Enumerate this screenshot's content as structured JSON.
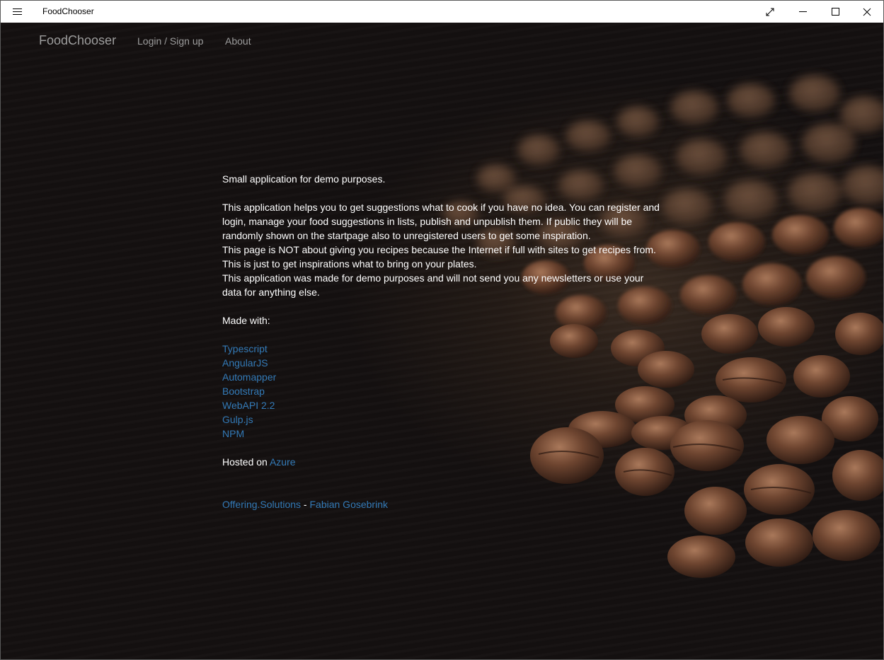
{
  "window": {
    "title": "FoodChooser"
  },
  "navbar": {
    "brand": "FoodChooser",
    "login": "Login / Sign up",
    "about": "About"
  },
  "main": {
    "intro": "Small application for demo purposes.",
    "description_lines": [
      "This application helps you to get suggestions what to cook if you have no idea. You can register and",
      "login, manage your food suggestions in lists, publish and unpublish them. If public they will be",
      "randomly shown on the startpage also to unregistered users to get some inspiration.",
      "This page is NOT about giving you recipes because the Internet if full with sites to get recipes from.",
      "This is just to get inspirations what to bring on your plates.",
      "This application was made for demo purposes and will not send you any newsletters or use your",
      "data for anything else."
    ],
    "made_with_label": "Made with:",
    "technologies": [
      "Typescript",
      "AngularJS",
      "Automapper",
      "Bootstrap",
      "WebAPI 2.2",
      "Gulp.js",
      "NPM"
    ],
    "hosted_label": "Hosted on",
    "hosted_link": "Azure",
    "footer_link1": "Offering.Solutions",
    "footer_separator": " - ",
    "footer_link2": "Fabian Gosebrink"
  },
  "colors": {
    "link": "#337ab7",
    "nav_text": "#9d9d9d",
    "body_text": "#ffffff"
  }
}
